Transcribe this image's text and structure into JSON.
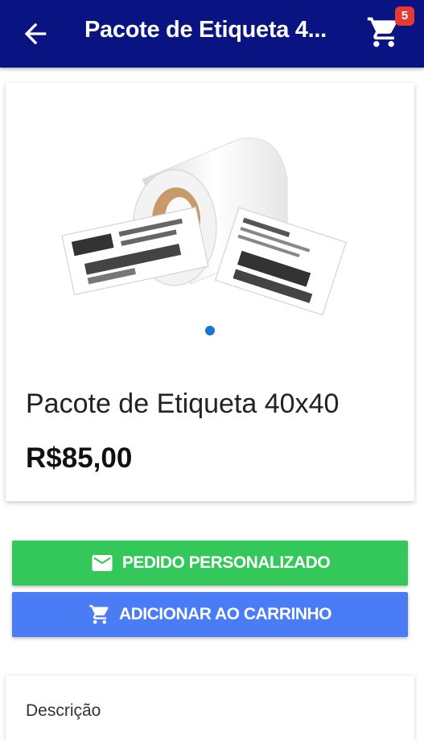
{
  "appbar": {
    "title": "Pacote de Etiqueta 4...",
    "cart_count": "5",
    "back_icon": "arrow-back-icon",
    "cart_icon": "shopping-cart-icon",
    "color": "#0a1382"
  },
  "product": {
    "name": "Pacote de Etiqueta 40x40",
    "price": "R$85,00",
    "carousel": {
      "total": 1,
      "active": 1
    }
  },
  "actions": {
    "custom_order_label": "PEDIDO PERSONALIZADO",
    "custom_order_icon": "email-icon",
    "custom_order_color": "#34c759",
    "add_to_cart_label": "ADICIONAR AO CARRINHO",
    "add_to_cart_icon": "shopping-cart-icon",
    "add_to_cart_color": "#4a7cf6"
  },
  "description": {
    "label": "Descrição"
  }
}
